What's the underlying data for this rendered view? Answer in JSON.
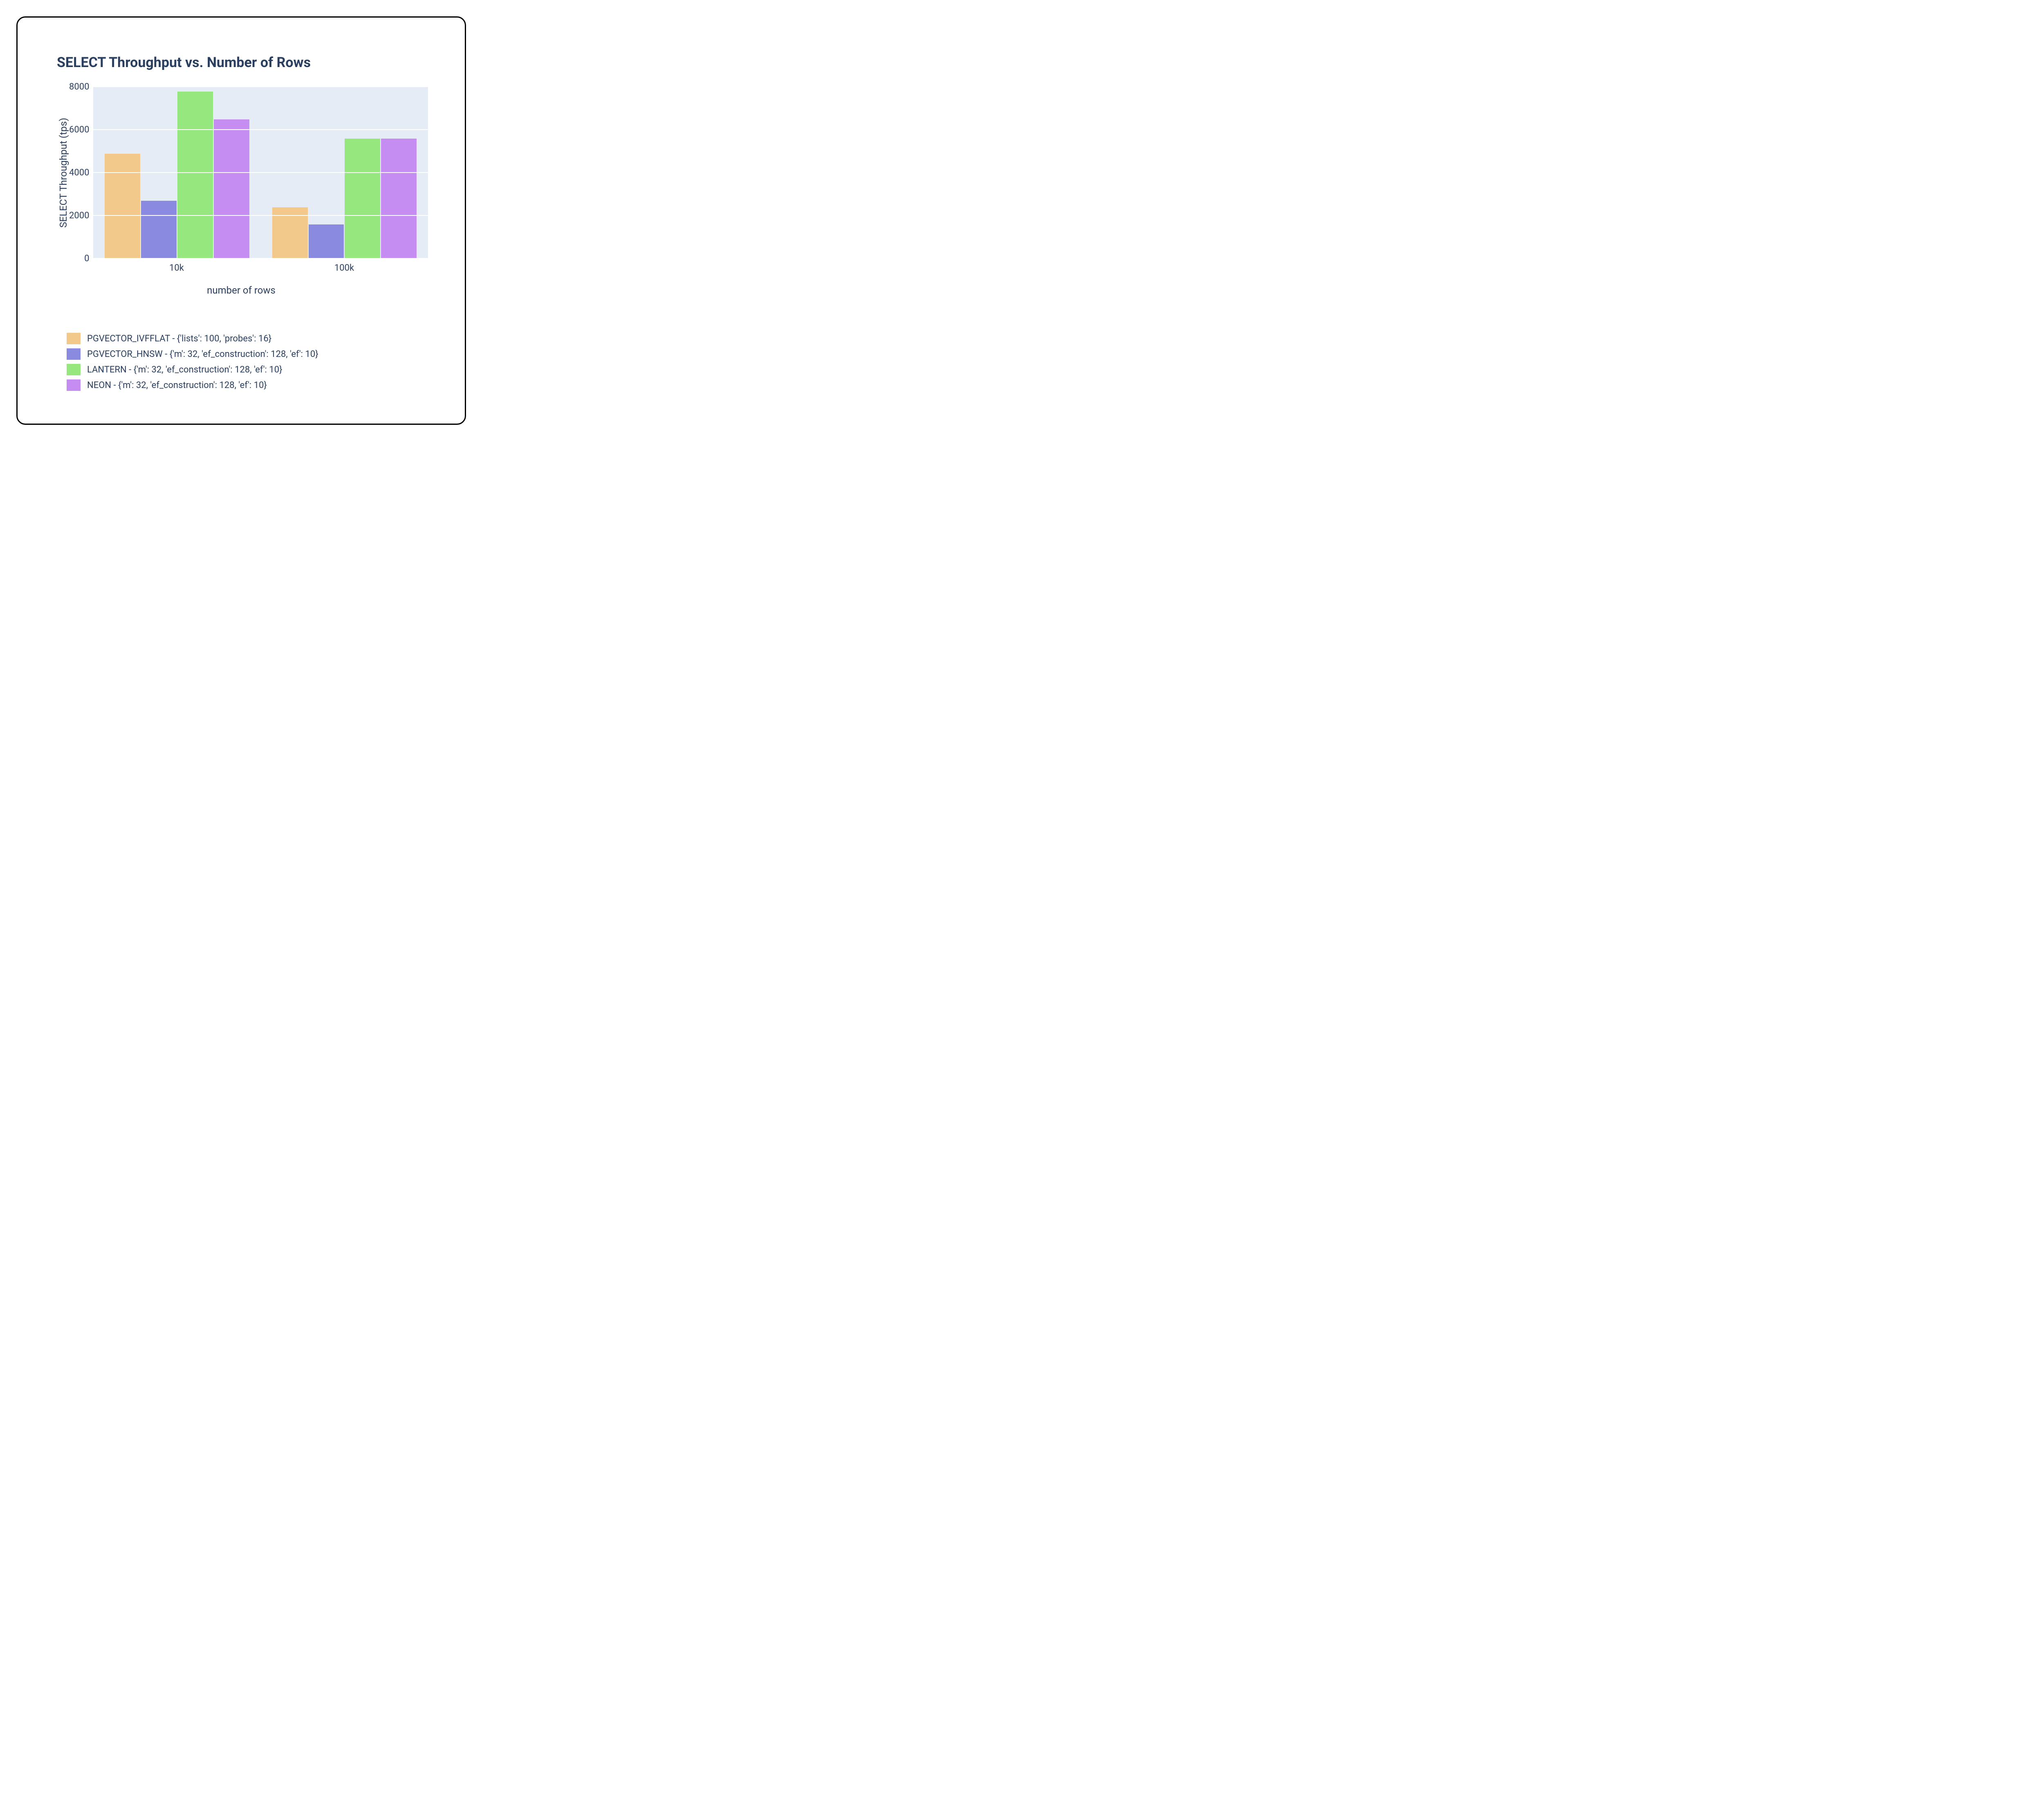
{
  "chart_data": {
    "type": "bar",
    "title": "SELECT Throughput vs. Number of Rows",
    "xlabel": "number of rows",
    "ylabel": "SELECT Throughput (tps)",
    "categories": [
      "10k",
      "100k"
    ],
    "ylim": [
      0,
      8000
    ],
    "yticks": [
      0,
      2000,
      4000,
      6000,
      8000
    ],
    "series": [
      {
        "name": "PGVECTOR_IVFFLAT - {'lists': 100, 'probes': 16}",
        "color": "#f3c88b",
        "values": [
          4900,
          2400
        ]
      },
      {
        "name": "PGVECTOR_HNSW - {'m': 32, 'ef_construction': 128, 'ef': 10}",
        "color": "#8a8be0",
        "values": [
          2700,
          1600
        ]
      },
      {
        "name": "LANTERN - {'m': 32, 'ef_construction': 128, 'ef': 10}",
        "color": "#95e77e",
        "values": [
          7800,
          5600
        ]
      },
      {
        "name": "NEON - {'m': 32, 'ef_construction': 128, 'ef': 10}",
        "color": "#c58cf2",
        "values": [
          6500,
          5600
        ]
      }
    ],
    "grid": true,
    "legend_position": "bottom"
  }
}
